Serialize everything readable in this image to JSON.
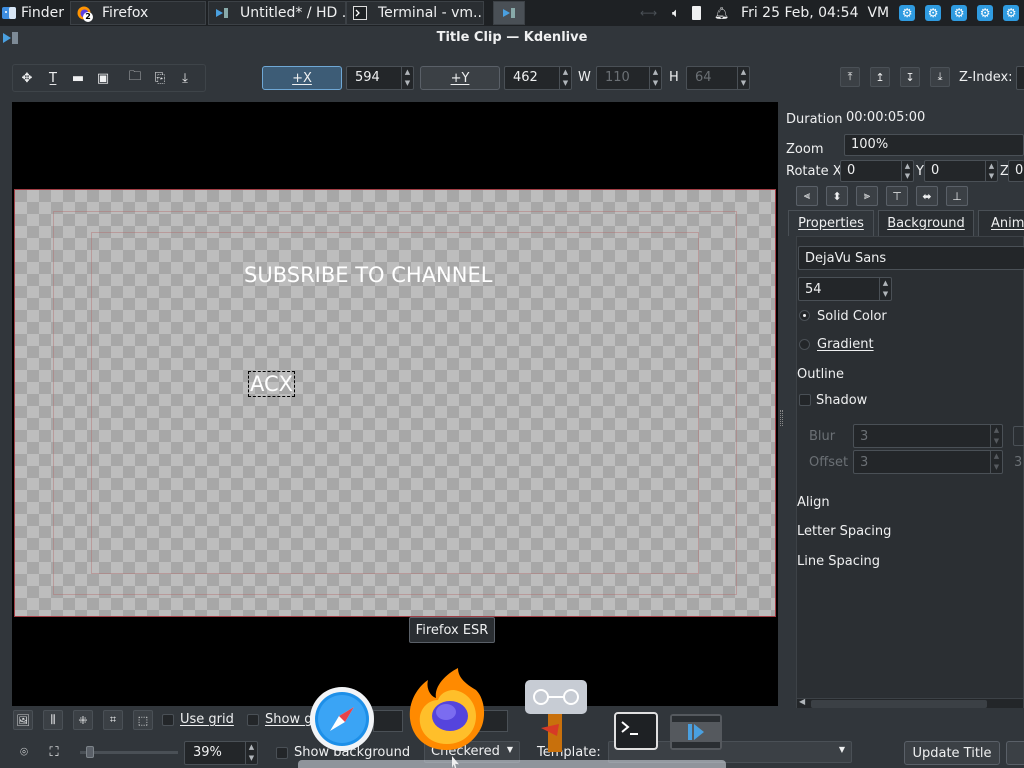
{
  "taskbar": {
    "tasks": [
      {
        "label": "Finder",
        "icon": "finder-icon"
      },
      {
        "label": "Firefox",
        "icon": "firefox-icon",
        "badge": "2"
      },
      {
        "label": "Untitled* / HD ...",
        "icon": "kdenlive-icon"
      },
      {
        "label": "Terminal - vm...",
        "icon": "terminal-icon"
      }
    ],
    "datetime": "Fri 25 Feb, 04:54",
    "vm_label": "VM",
    "tray_icons": [
      "network-icon",
      "volume-icon",
      "battery-icon",
      "notification-icon"
    ]
  },
  "window": {
    "title": "Title Clip — Kdenlive"
  },
  "toolbar": {
    "x_button": "+X",
    "x_value": "594",
    "y_button": "+Y",
    "y_value": "462",
    "w_label": "W",
    "w_value": "110",
    "h_label": "H",
    "h_value": "64",
    "zindex_label": "Z-Index:"
  },
  "canvas": {
    "items": [
      {
        "text": "SUBSRIBE TO CHANNEL"
      },
      {
        "text": "ACX",
        "selected": true
      }
    ]
  },
  "panel": {
    "duration_label": "Duration",
    "duration_value": "00:00:05:00",
    "zoom_label": "Zoom",
    "zoom_value": "100%",
    "rotate_x_label": "Rotate X",
    "rotate_x_value": "0",
    "rotate_y_label": "Y",
    "rotate_y_value": "0",
    "rotate_z_label": "Z",
    "rotate_z_value": "0",
    "tabs": [
      "Properties",
      "Background",
      "Anim"
    ],
    "font_family": "DejaVu Sans",
    "font_size": "54",
    "solid_color_label": "Solid Color",
    "gradient_label": "Gradient",
    "outline_label": "Outline",
    "shadow_label": "Shadow",
    "blur_label": "Blur",
    "blur_value": "3",
    "offset_label": "Offset",
    "offset_value": "3",
    "offset_value2": "3",
    "align_label": "Align",
    "letter_spacing_label": "Letter Spacing",
    "line_spacing_label": "Line Spacing"
  },
  "bottom": {
    "use_grid_label": "Use grid",
    "show_guides_label": "Show g",
    "zoom_percent": "39%",
    "show_background_label": "Show background",
    "background_combo": "Checkered",
    "template_label": "Template:",
    "update_title_label": "Update Title"
  },
  "dock": {
    "tooltip": "Firefox ESR",
    "apps": [
      "safari-icon",
      "firefox-icon",
      "kdenlive-signpost-icon",
      "terminal-icon",
      "kdenlive-clapper-icon"
    ]
  },
  "colors": {
    "accent": "#2f9be0",
    "window_bg": "#31363b",
    "taskbar_bg": "#1e2124",
    "frame_border": "#a23e45"
  }
}
